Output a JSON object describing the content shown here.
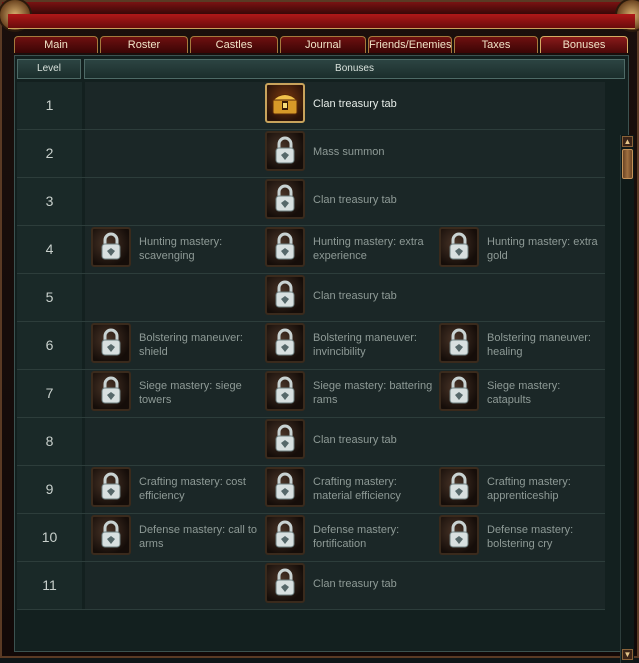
{
  "tabs": [
    "Main",
    "Roster",
    "Castles",
    "Journal",
    "Friends/Enemies",
    "Taxes",
    "Bonuses"
  ],
  "active_tab": "Bonuses",
  "table": {
    "headers": {
      "level": "Level",
      "bonuses": "Bonuses"
    },
    "rows": [
      {
        "level": "1",
        "bonuses": [
          {
            "text": "Clan treasury tab",
            "icon": "treasure-chest-icon",
            "unlocked": true
          }
        ]
      },
      {
        "level": "2",
        "bonuses": [
          {
            "text": "Mass summon",
            "icon": "lock-icon"
          }
        ]
      },
      {
        "level": "3",
        "bonuses": [
          {
            "text": "Clan treasury tab",
            "icon": "lock-icon"
          }
        ]
      },
      {
        "level": "4",
        "bonuses": [
          {
            "text": "Hunting mastery: scavenging",
            "icon": "lock-icon"
          },
          {
            "text": "Hunting mastery: extra experience",
            "icon": "lock-icon"
          },
          {
            "text": "Hunting mastery: extra gold",
            "icon": "lock-icon"
          }
        ]
      },
      {
        "level": "5",
        "bonuses": [
          {
            "text": "Clan treasury tab",
            "icon": "lock-icon"
          }
        ]
      },
      {
        "level": "6",
        "bonuses": [
          {
            "text": "Bolstering maneuver: shield",
            "icon": "lock-icon"
          },
          {
            "text": "Bolstering maneuver: invincibility",
            "icon": "lock-icon"
          },
          {
            "text": "Bolstering maneuver: healing",
            "icon": "lock-icon"
          }
        ]
      },
      {
        "level": "7",
        "bonuses": [
          {
            "text": "Siege mastery: siege towers",
            "icon": "lock-icon"
          },
          {
            "text": "Siege mastery: battering rams",
            "icon": "lock-icon"
          },
          {
            "text": "Siege mastery: catapults",
            "icon": "lock-icon"
          }
        ]
      },
      {
        "level": "8",
        "bonuses": [
          {
            "text": "Clan treasury tab",
            "icon": "lock-icon"
          }
        ]
      },
      {
        "level": "9",
        "bonuses": [
          {
            "text": "Crafting mastery: cost efficiency",
            "icon": "lock-icon"
          },
          {
            "text": "Crafting mastery: material efficiency",
            "icon": "lock-icon"
          },
          {
            "text": "Crafting mastery: apprenticeship",
            "icon": "lock-icon"
          }
        ]
      },
      {
        "level": "10",
        "bonuses": [
          {
            "text": "Defense mastery: call to arms",
            "icon": "lock-icon"
          },
          {
            "text": "Defense mastery: fortification",
            "icon": "lock-icon"
          },
          {
            "text": "Defense mastery: bolstering cry",
            "icon": "lock-icon"
          }
        ]
      },
      {
        "level": "11",
        "bonuses": [
          {
            "text": "Clan treasury tab",
            "icon": "lock-icon"
          }
        ]
      }
    ]
  },
  "scroll": {
    "up_icon": "scroll-up-arrow-icon",
    "down_icon": "scroll-down-arrow-icon"
  }
}
